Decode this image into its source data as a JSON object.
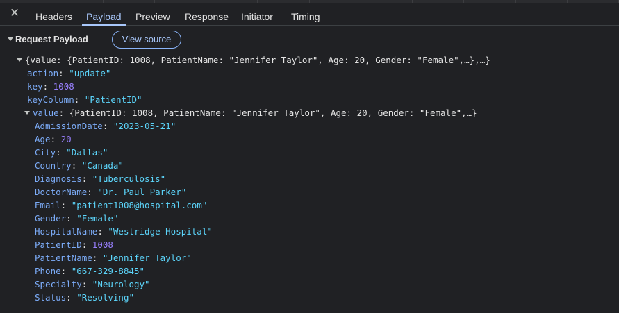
{
  "tabs": [
    {
      "label": "Headers"
    },
    {
      "label": "Payload"
    },
    {
      "label": "Preview"
    },
    {
      "label": "Response"
    },
    {
      "label": "Initiator"
    },
    {
      "label": "Timing"
    }
  ],
  "close_glyph": "✕",
  "section": {
    "title": "Request Payload",
    "view_source_label": "View source"
  },
  "payload": {
    "root_summary": "{value: {PatientID: 1008, PatientName: \"Jennifer Taylor\", Age: 20, Gender: \"Female\",…},…}",
    "top": [
      {
        "key": "action",
        "sep": ": ",
        "value": "\"update\"",
        "kind": "str"
      },
      {
        "key": "key",
        "sep": ": ",
        "value": "1008",
        "kind": "num"
      },
      {
        "key": "keyColumn",
        "sep": ": ",
        "value": "\"PatientID\"",
        "kind": "str"
      }
    ],
    "value_key": "value",
    "value_summary": "{PatientID: 1008, PatientName: \"Jennifer Taylor\", Age: 20, Gender: \"Female\",…}",
    "fields": [
      {
        "key": "AdmissionDate",
        "value": "\"2023-05-21\"",
        "kind": "str"
      },
      {
        "key": "Age",
        "value": "20",
        "kind": "num"
      },
      {
        "key": "City",
        "value": "\"Dallas\"",
        "kind": "str"
      },
      {
        "key": "Country",
        "value": "\"Canada\"",
        "kind": "str"
      },
      {
        "key": "Diagnosis",
        "value": "\"Tuberculosis\"",
        "kind": "str"
      },
      {
        "key": "DoctorName",
        "value": "\"Dr. Paul Parker\"",
        "kind": "str"
      },
      {
        "key": "Email",
        "value": "\"patient1008@hospital.com\"",
        "kind": "str"
      },
      {
        "key": "Gender",
        "value": "\"Female\"",
        "kind": "str"
      },
      {
        "key": "HospitalName",
        "value": "\"Westridge Hospital\"",
        "kind": "str"
      },
      {
        "key": "PatientID",
        "value": "1008",
        "kind": "num"
      },
      {
        "key": "PatientName",
        "value": "\"Jennifer Taylor\"",
        "kind": "str"
      },
      {
        "key": "Phone",
        "value": "\"667-329-8845\"",
        "kind": "str"
      },
      {
        "key": "Specialty",
        "value": "\"Neurology\"",
        "kind": "str"
      },
      {
        "key": "Status",
        "value": "\"Resolving\"",
        "kind": "str"
      }
    ]
  }
}
